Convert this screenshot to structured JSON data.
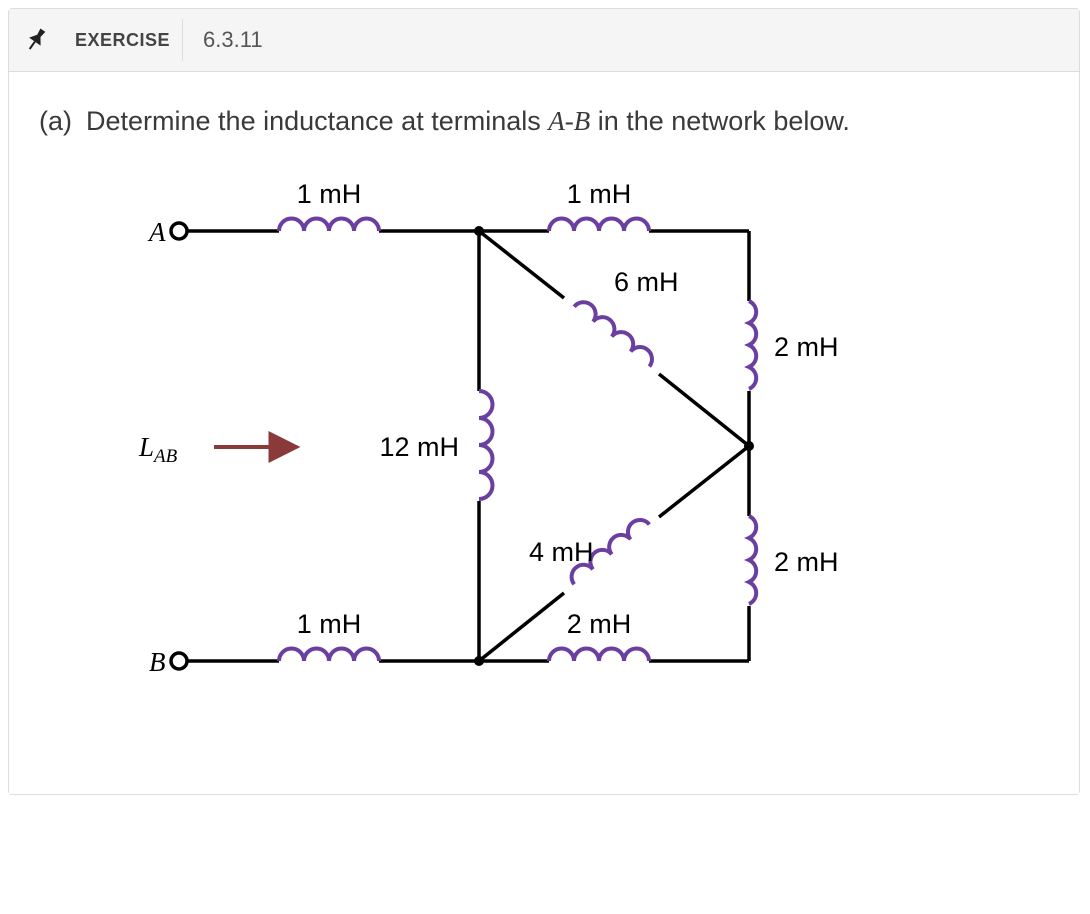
{
  "header": {
    "title": "EXERCISE",
    "number": "6.3.11"
  },
  "question": {
    "part": "(a)",
    "text_before": "Determine the inductance at terminals ",
    "variable": "A-B",
    "text_after": " in the network below."
  },
  "diagram": {
    "terminals": {
      "A": "A",
      "B": "B"
    },
    "pointer_label": "L",
    "pointer_subscript": "AB",
    "components": {
      "top_left": {
        "value": "1 mH",
        "type": "inductor"
      },
      "top_right": {
        "value": "1 mH",
        "type": "inductor"
      },
      "mid_vert": {
        "value": "12 mH",
        "type": "inductor"
      },
      "diag_upper": {
        "value": "6 mH",
        "type": "inductor"
      },
      "diag_lower": {
        "value": "4 mH",
        "type": "inductor"
      },
      "right_upper": {
        "value": "2 mH",
        "type": "inductor"
      },
      "right_lower": {
        "value": "2 mH",
        "type": "inductor"
      },
      "bot_left": {
        "value": "1 mH",
        "type": "inductor"
      },
      "bot_right": {
        "value": "2 mH",
        "type": "inductor"
      }
    }
  }
}
